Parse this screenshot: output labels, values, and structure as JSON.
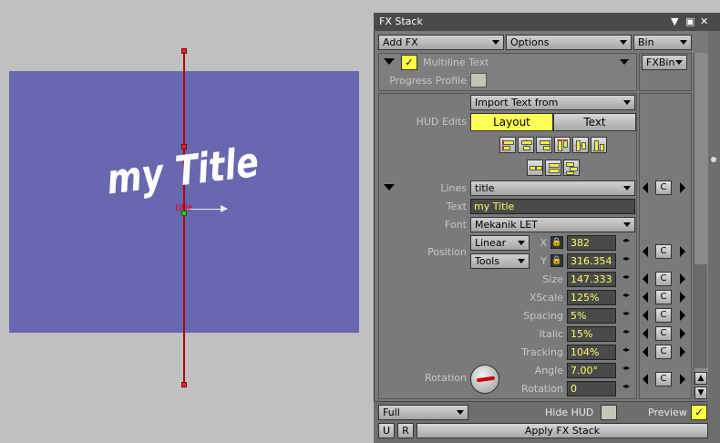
{
  "window": {
    "title": "FX Stack"
  },
  "toolbar": {
    "add_fx": "Add FX",
    "options": "Options",
    "bin": "Bin"
  },
  "effect": {
    "name": "Multiline Text",
    "fxbin": "FXBin",
    "progress_profile": "Progress Profile"
  },
  "import": {
    "label": "Import Text from"
  },
  "hud": {
    "label": "HUD Edits",
    "layout": "Layout",
    "text": "Text"
  },
  "lines": {
    "label": "Lines",
    "value": "title"
  },
  "text": {
    "label": "Text",
    "value": "my Title"
  },
  "font": {
    "label": "Font",
    "value": "Mekanik LET"
  },
  "position": {
    "label": "Position",
    "mode1": "Linear",
    "mode2": "Tools",
    "x_label": "X",
    "x_value": "382",
    "y_label": "Y",
    "y_value": "316.354"
  },
  "params": [
    {
      "label": "Size",
      "value": "147.333"
    },
    {
      "label": "XScale",
      "value": "125%"
    },
    {
      "label": "Spacing",
      "value": "5%"
    },
    {
      "label": "Italic",
      "value": "15%"
    },
    {
      "label": "Tracking",
      "value": "104%"
    },
    {
      "label": "Angle",
      "value": "7.00°"
    },
    {
      "label": "Rotation",
      "value": "0"
    }
  ],
  "rotation_label": "Rotation",
  "c_label": "C",
  "bottom": {
    "quality": "Full",
    "hide_hud": "Hide HUD",
    "preview": "Preview",
    "u": "U",
    "r": "R",
    "apply": "Apply FX Stack"
  },
  "canvas": {
    "title_text": "my Title",
    "anchor_label": "title"
  },
  "colors": {
    "accent_yellow": "#ffff44",
    "panel_bg": "#7a7a7a",
    "canvas_bg": "#6868b0",
    "guide_red": "#b00000"
  }
}
